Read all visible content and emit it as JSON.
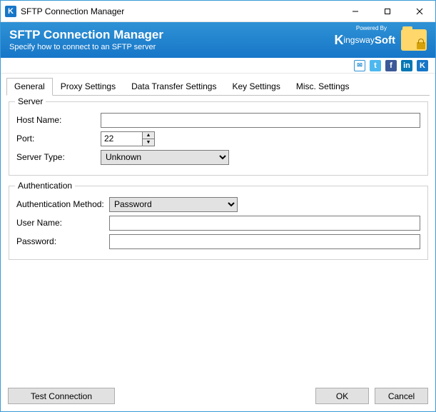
{
  "window": {
    "title": "SFTP Connection Manager"
  },
  "banner": {
    "title": "SFTP Connection Manager",
    "subtitle": "Specify how to connect to an SFTP server",
    "powered_by": "Powered By",
    "brand": "KingswaySoft"
  },
  "tabs": {
    "general": "General",
    "proxy": "Proxy Settings",
    "data_transfer": "Data Transfer Settings",
    "key": "Key Settings",
    "misc": "Misc. Settings"
  },
  "server_group": {
    "legend": "Server",
    "host_label": "Host Name:",
    "host_value": "",
    "port_label": "Port:",
    "port_value": "22",
    "type_label": "Server Type:",
    "type_value": "Unknown"
  },
  "auth_group": {
    "legend": "Authentication",
    "method_label": "Authentication Method:",
    "method_value": "Password",
    "user_label": "User Name:",
    "user_value": "",
    "password_label": "Password:",
    "password_value": ""
  },
  "footer": {
    "test": "Test Connection",
    "ok": "OK",
    "cancel": "Cancel"
  }
}
